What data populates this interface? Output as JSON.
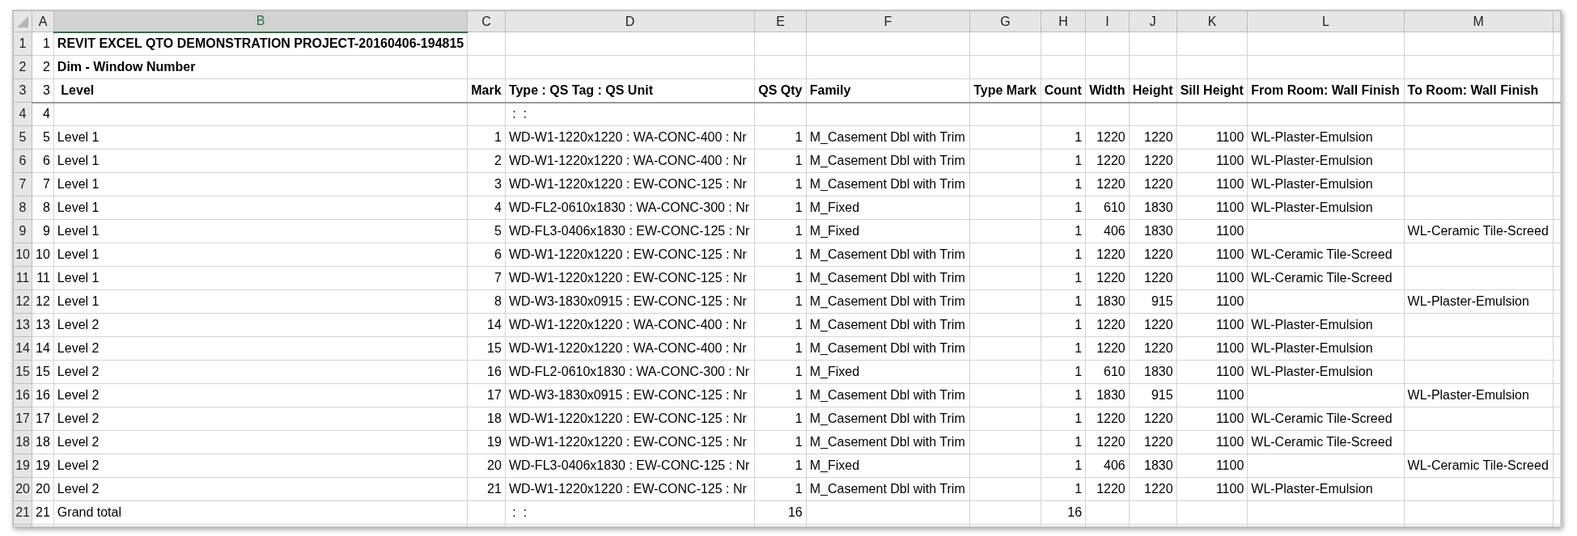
{
  "column_headers": [
    {
      "label": "A",
      "selected": false
    },
    {
      "label": "B",
      "selected": true
    },
    {
      "label": "C",
      "selected": false
    },
    {
      "label": "D",
      "selected": false
    },
    {
      "label": "E",
      "selected": false
    },
    {
      "label": "F",
      "selected": false
    },
    {
      "label": "G",
      "selected": false
    },
    {
      "label": "H",
      "selected": false
    },
    {
      "label": "I",
      "selected": false
    },
    {
      "label": "J",
      "selected": false
    },
    {
      "label": "K",
      "selected": false
    },
    {
      "label": "L",
      "selected": false
    },
    {
      "label": "M",
      "selected": false
    }
  ],
  "rows": [
    {
      "number": "1",
      "kind": "title",
      "cells": {
        "a": "1",
        "b": "REVIT EXCEL QTO DEMONSTRATION PROJECT-20160406-194815"
      }
    },
    {
      "number": "2",
      "kind": "title",
      "cells": {
        "a": "2",
        "b": "Dim - Window Number"
      }
    },
    {
      "number": "3",
      "kind": "header",
      "cells": {
        "a": "3",
        "b": " Level",
        "c": "Mark",
        "d": "Type : QS Tag : QS Unit",
        "e": "QS Qty",
        "f": "Family",
        "g": "Type Mark",
        "h": "Count",
        "i": "Width",
        "j": "Height",
        "k": "Sill Height",
        "l": "From Room: Wall Finish",
        "m": "To Room: Wall Finish"
      }
    },
    {
      "number": "4",
      "kind": "data",
      "cells": {
        "a": "4",
        "d": " :  :"
      }
    },
    {
      "number": "5",
      "kind": "data",
      "cells": {
        "a": "5",
        "b": "Level 1",
        "c": "1",
        "d": "WD-W1-1220x1220 : WA-CONC-400 : Nr",
        "e": "1",
        "f": "M_Casement Dbl with Trim",
        "h": "1",
        "i": "1220",
        "j": "1220",
        "k": "1100",
        "l": "WL-Plaster-Emulsion"
      }
    },
    {
      "number": "6",
      "kind": "data",
      "cells": {
        "a": "6",
        "b": "Level 1",
        "c": "2",
        "d": "WD-W1-1220x1220 : WA-CONC-400 : Nr",
        "e": "1",
        "f": "M_Casement Dbl with Trim",
        "h": "1",
        "i": "1220",
        "j": "1220",
        "k": "1100",
        "l": "WL-Plaster-Emulsion"
      }
    },
    {
      "number": "7",
      "kind": "data",
      "cells": {
        "a": "7",
        "b": "Level 1",
        "c": "3",
        "d": "WD-W1-1220x1220 : EW-CONC-125 : Nr",
        "e": "1",
        "f": "M_Casement Dbl with Trim",
        "h": "1",
        "i": "1220",
        "j": "1220",
        "k": "1100",
        "l": "WL-Plaster-Emulsion"
      }
    },
    {
      "number": "8",
      "kind": "data",
      "cells": {
        "a": "8",
        "b": "Level 1",
        "c": "4",
        "d": "WD-FL2-0610x1830 : WA-CONC-300 : Nr",
        "e": "1",
        "f": "M_Fixed",
        "h": "1",
        "i": "610",
        "j": "1830",
        "k": "1100",
        "l": "WL-Plaster-Emulsion"
      }
    },
    {
      "number": "9",
      "kind": "data",
      "cells": {
        "a": "9",
        "b": "Level 1",
        "c": "5",
        "d": "WD-FL3-0406x1830 : EW-CONC-125 : Nr",
        "e": "1",
        "f": "M_Fixed",
        "h": "1",
        "i": "406",
        "j": "1830",
        "k": "1100",
        "m": "WL-Ceramic Tile-Screed"
      }
    },
    {
      "number": "10",
      "kind": "data",
      "cells": {
        "a": "10",
        "b": "Level 1",
        "c": "6",
        "d": "WD-W1-1220x1220 : EW-CONC-125 : Nr",
        "e": "1",
        "f": "M_Casement Dbl with Trim",
        "h": "1",
        "i": "1220",
        "j": "1220",
        "k": "1100",
        "l": "WL-Ceramic Tile-Screed"
      }
    },
    {
      "number": "11",
      "kind": "data",
      "cells": {
        "a": "11",
        "b": "Level 1",
        "c": "7",
        "d": "WD-W1-1220x1220 : EW-CONC-125 : Nr",
        "e": "1",
        "f": "M_Casement Dbl with Trim",
        "h": "1",
        "i": "1220",
        "j": "1220",
        "k": "1100",
        "l": "WL-Ceramic Tile-Screed"
      }
    },
    {
      "number": "12",
      "kind": "data",
      "cells": {
        "a": "12",
        "b": "Level 1",
        "c": "8",
        "d": "WD-W3-1830x0915 : EW-CONC-125 : Nr",
        "e": "1",
        "f": "M_Casement Dbl with Trim",
        "h": "1",
        "i": "1830",
        "j": "915",
        "k": "1100",
        "m": "WL-Plaster-Emulsion"
      }
    },
    {
      "number": "13",
      "kind": "data",
      "cells": {
        "a": "13",
        "b": "Level 2",
        "c": "14",
        "d": "WD-W1-1220x1220 : WA-CONC-400 : Nr",
        "e": "1",
        "f": "M_Casement Dbl with Trim",
        "h": "1",
        "i": "1220",
        "j": "1220",
        "k": "1100",
        "l": "WL-Plaster-Emulsion"
      }
    },
    {
      "number": "14",
      "kind": "data",
      "cells": {
        "a": "14",
        "b": "Level 2",
        "c": "15",
        "d": "WD-W1-1220x1220 : WA-CONC-400 : Nr",
        "e": "1",
        "f": "M_Casement Dbl with Trim",
        "h": "1",
        "i": "1220",
        "j": "1220",
        "k": "1100",
        "l": "WL-Plaster-Emulsion"
      }
    },
    {
      "number": "15",
      "kind": "data",
      "cells": {
        "a": "15",
        "b": "Level 2",
        "c": "16",
        "d": "WD-FL2-0610x1830 : WA-CONC-300 : Nr",
        "e": "1",
        "f": "M_Fixed",
        "h": "1",
        "i": "610",
        "j": "1830",
        "k": "1100",
        "l": "WL-Plaster-Emulsion"
      }
    },
    {
      "number": "16",
      "kind": "data",
      "cells": {
        "a": "16",
        "b": "Level 2",
        "c": "17",
        "d": "WD-W3-1830x0915 : EW-CONC-125 : Nr",
        "e": "1",
        "f": "M_Casement Dbl with Trim",
        "h": "1",
        "i": "1830",
        "j": "915",
        "k": "1100",
        "m": "WL-Plaster-Emulsion"
      }
    },
    {
      "number": "17",
      "kind": "data",
      "cells": {
        "a": "17",
        "b": "Level 2",
        "c": "18",
        "d": "WD-W1-1220x1220 : EW-CONC-125 : Nr",
        "e": "1",
        "f": "M_Casement Dbl with Trim",
        "h": "1",
        "i": "1220",
        "j": "1220",
        "k": "1100",
        "l": "WL-Ceramic Tile-Screed"
      }
    },
    {
      "number": "18",
      "kind": "data",
      "cells": {
        "a": "18",
        "b": "Level 2",
        "c": "19",
        "d": "WD-W1-1220x1220 : EW-CONC-125 : Nr",
        "e": "1",
        "f": "M_Casement Dbl with Trim",
        "h": "1",
        "i": "1220",
        "j": "1220",
        "k": "1100",
        "l": "WL-Ceramic Tile-Screed"
      }
    },
    {
      "number": "19",
      "kind": "data",
      "cells": {
        "a": "19",
        "b": "Level 2",
        "c": "20",
        "d": "WD-FL3-0406x1830 : EW-CONC-125 : Nr",
        "e": "1",
        "f": "M_Fixed",
        "h": "1",
        "i": "406",
        "j": "1830",
        "k": "1100",
        "m": "WL-Ceramic Tile-Screed"
      }
    },
    {
      "number": "20",
      "kind": "data",
      "cells": {
        "a": "20",
        "b": "Level 2",
        "c": "21",
        "d": "WD-W1-1220x1220 : EW-CONC-125 : Nr",
        "e": "1",
        "f": "M_Casement Dbl with Trim",
        "h": "1",
        "i": "1220",
        "j": "1220",
        "k": "1100",
        "l": "WL-Plaster-Emulsion"
      }
    },
    {
      "number": "21",
      "kind": "total",
      "cells": {
        "a": "21",
        "b": "Grand total",
        "d": " :  :",
        "e": "16",
        "h": "16"
      }
    }
  ]
}
